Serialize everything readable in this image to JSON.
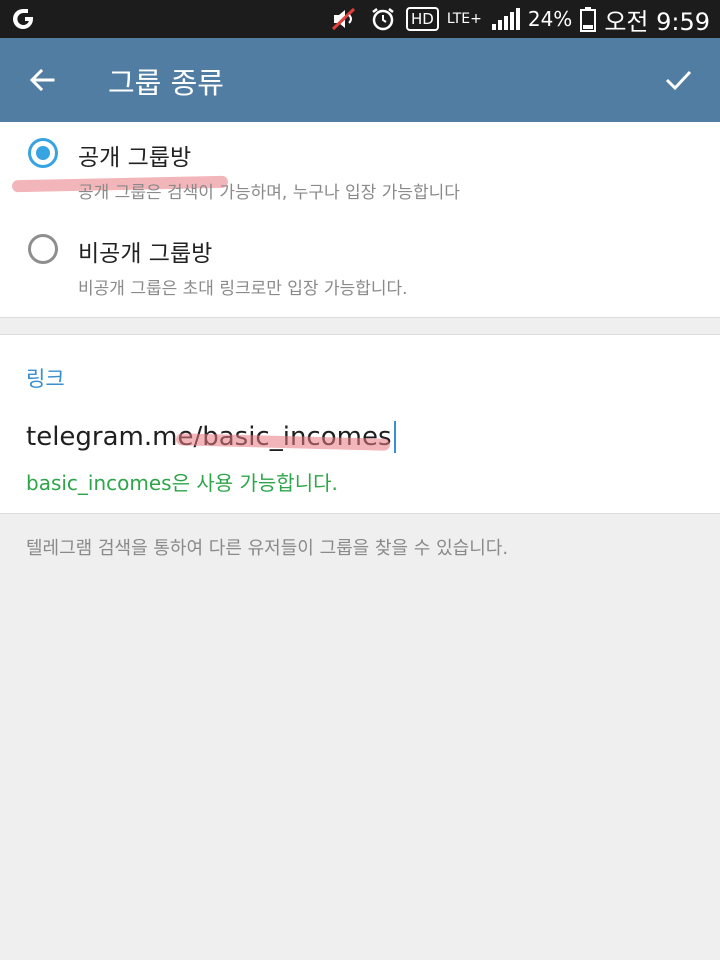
{
  "status_bar": {
    "left_icon": "carrier-logo-icon",
    "icons": [
      "mute-icon",
      "alarm-icon",
      "hd-icon",
      "lte-icon",
      "signal-icon",
      "battery-icon"
    ],
    "hd_label": "HD",
    "lte_label": "LTE+",
    "battery_percent": "24%",
    "time": "오전 9:59"
  },
  "app_bar": {
    "title": "그룹 종류",
    "back_icon": "back-arrow-icon",
    "done_icon": "checkmark-icon",
    "color": "#517da2"
  },
  "group_type": {
    "options": [
      {
        "label": "공개 그룹방",
        "description": "공개 그룹은 검색이 가능하며, 누구나 입장 가능합니다",
        "selected": true
      },
      {
        "label": "비공개 그룹방",
        "description": "비공개 그룹은 초대 링크로만 입장 가능합니다.",
        "selected": false
      }
    ],
    "accent": "#37a4e2"
  },
  "link": {
    "header": "링크",
    "prefix": "telegram.me/",
    "value": "basic_incomes",
    "status": "basic_incomes은 사용 가능합니다.",
    "status_color": "#2ea54a"
  },
  "hint": "텔레그램 검색을 통하여 다른 유저들이 그룹을 찾을 수 있습니다."
}
